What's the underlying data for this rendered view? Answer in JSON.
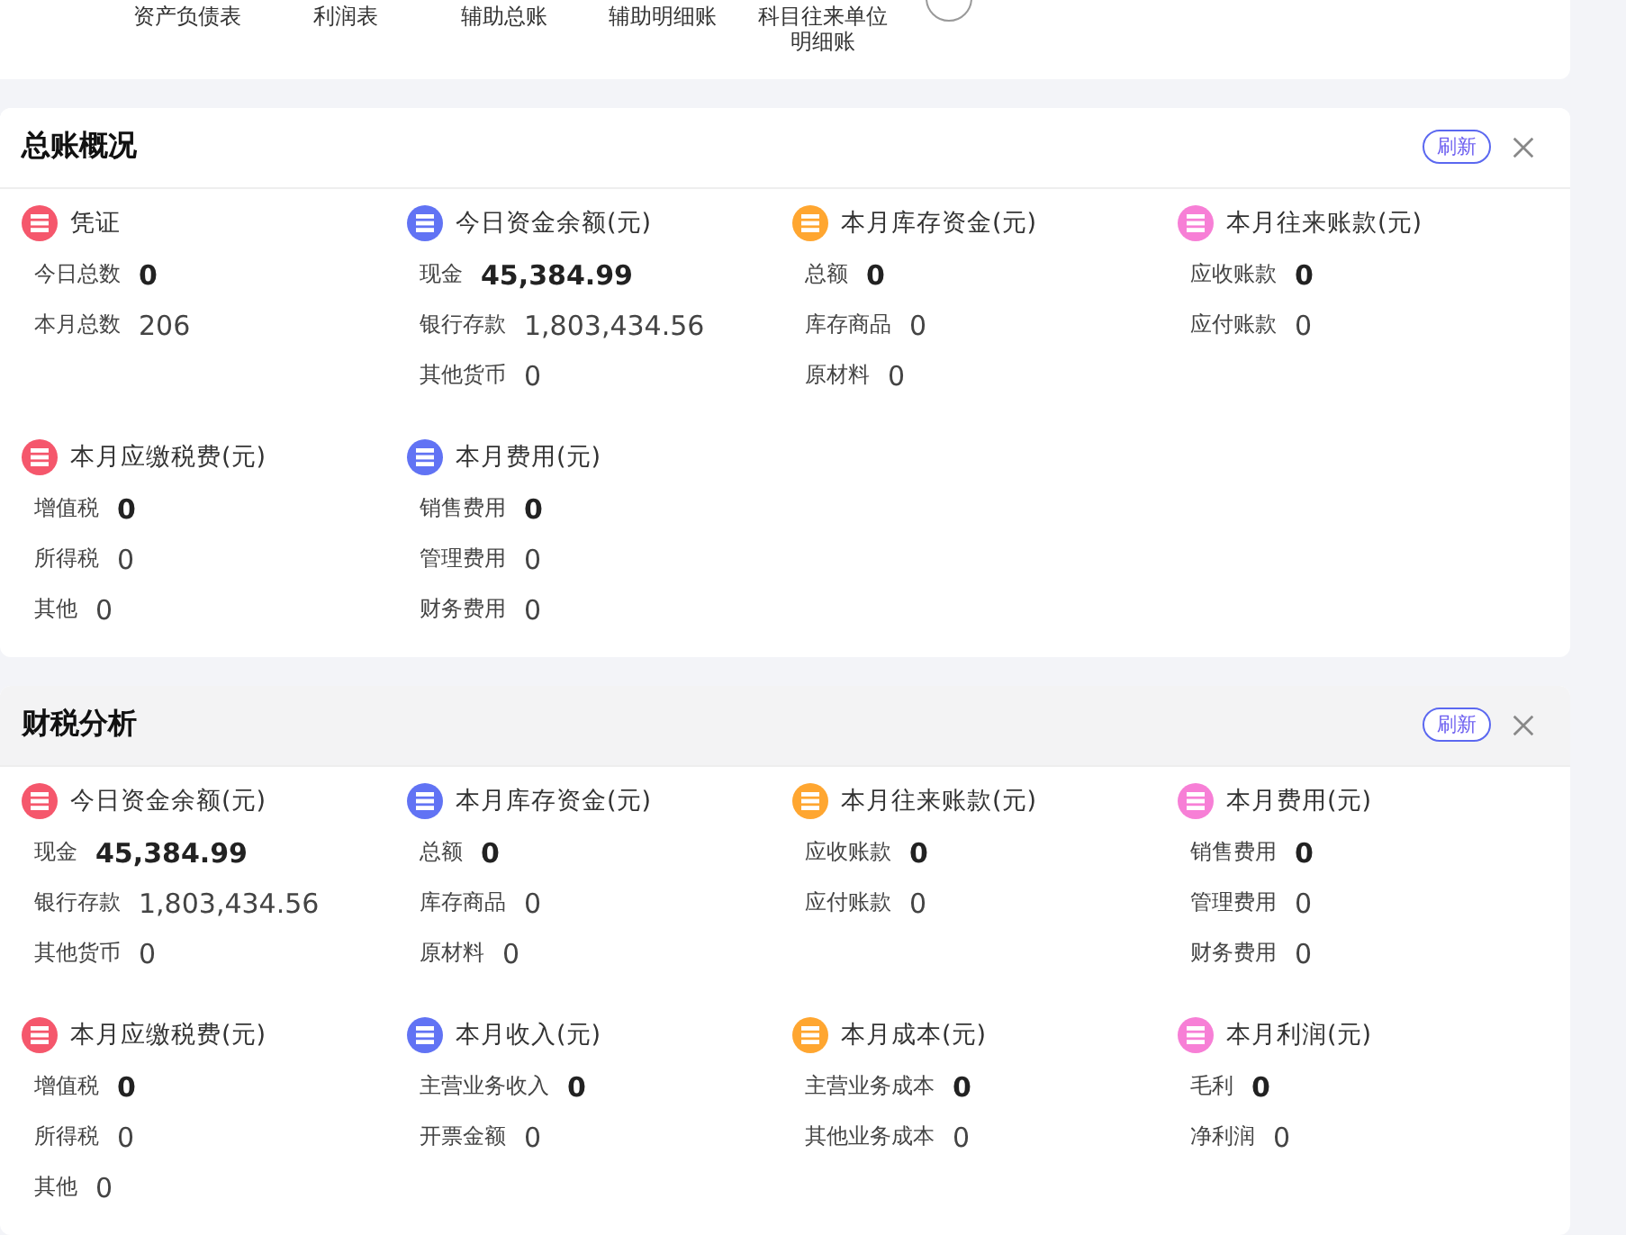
{
  "shortcuts": [
    {
      "label": "资产负债表"
    },
    {
      "label": "利润表"
    },
    {
      "label": "辅助总账"
    },
    {
      "label": "辅助明细账"
    },
    {
      "label": "科目往来单位明细账"
    }
  ],
  "panels": [
    {
      "title": "总账概况",
      "header_highlighted": false,
      "refresh_label": "刷新",
      "groups": [
        {
          "title": "凭证",
          "color": "#f5576c",
          "rows": [
            {
              "label": "今日总数",
              "value": "0",
              "bold": true
            },
            {
              "label": "本月总数",
              "value": "206",
              "bold": false
            }
          ]
        },
        {
          "title": "今日资金余额(元)",
          "color": "#6173f4",
          "rows": [
            {
              "label": "现金",
              "value": "45,384.99",
              "bold": true
            },
            {
              "label": "银行存款",
              "value": "1,803,434.56",
              "bold": false
            },
            {
              "label": "其他货币",
              "value": "0",
              "bold": false
            }
          ]
        },
        {
          "title": "本月库存资金(元)",
          "color": "#ffa630",
          "rows": [
            {
              "label": "总额",
              "value": "0",
              "bold": true
            },
            {
              "label": "库存商品",
              "value": "0",
              "bold": false
            },
            {
              "label": "原材料",
              "value": "0",
              "bold": false
            }
          ]
        },
        {
          "title": "本月往来账款(元)",
          "color": "#f77fd6",
          "rows": [
            {
              "label": "应收账款",
              "value": "0",
              "bold": true
            },
            {
              "label": "应付账款",
              "value": "0",
              "bold": false
            }
          ]
        },
        {
          "title": "本月应缴税费(元)",
          "color": "#f5576c",
          "rows": [
            {
              "label": "增值税",
              "value": "0",
              "bold": true
            },
            {
              "label": "所得税",
              "value": "0",
              "bold": false
            },
            {
              "label": "其他",
              "value": "0",
              "bold": false
            }
          ]
        },
        {
          "title": "本月费用(元)",
          "color": "#6173f4",
          "rows": [
            {
              "label": "销售费用",
              "value": "0",
              "bold": true
            },
            {
              "label": "管理费用",
              "value": "0",
              "bold": false
            },
            {
              "label": "财务费用",
              "value": "0",
              "bold": false
            }
          ]
        }
      ]
    },
    {
      "title": "财税分析",
      "header_highlighted": true,
      "refresh_label": "刷新",
      "groups": [
        {
          "title": "今日资金余额(元)",
          "color": "#f5576c",
          "rows": [
            {
              "label": "现金",
              "value": "45,384.99",
              "bold": true
            },
            {
              "label": "银行存款",
              "value": "1,803,434.56",
              "bold": false
            },
            {
              "label": "其他货币",
              "value": "0",
              "bold": false
            }
          ]
        },
        {
          "title": "本月库存资金(元)",
          "color": "#6173f4",
          "rows": [
            {
              "label": "总额",
              "value": "0",
              "bold": true
            },
            {
              "label": "库存商品",
              "value": "0",
              "bold": false
            },
            {
              "label": "原材料",
              "value": "0",
              "bold": false
            }
          ]
        },
        {
          "title": "本月往来账款(元)",
          "color": "#ffa630",
          "rows": [
            {
              "label": "应收账款",
              "value": "0",
              "bold": true
            },
            {
              "label": "应付账款",
              "value": "0",
              "bold": false
            }
          ]
        },
        {
          "title": "本月费用(元)",
          "color": "#f77fd6",
          "rows": [
            {
              "label": "销售费用",
              "value": "0",
              "bold": true
            },
            {
              "label": "管理费用",
              "value": "0",
              "bold": false
            },
            {
              "label": "财务费用",
              "value": "0",
              "bold": false
            }
          ]
        },
        {
          "title": "本月应缴税费(元)",
          "color": "#f5576c",
          "rows": [
            {
              "label": "增值税",
              "value": "0",
              "bold": true
            },
            {
              "label": "所得税",
              "value": "0",
              "bold": false
            },
            {
              "label": "其他",
              "value": "0",
              "bold": false
            }
          ]
        },
        {
          "title": "本月收入(元)",
          "color": "#6173f4",
          "rows": [
            {
              "label": "主营业务收入",
              "value": "0",
              "bold": true
            },
            {
              "label": "开票金额",
              "value": "0",
              "bold": false
            }
          ]
        },
        {
          "title": "本月成本(元)",
          "color": "#ffa630",
          "rows": [
            {
              "label": "主营业务成本",
              "value": "0",
              "bold": true
            },
            {
              "label": "其他业务成本",
              "value": "0",
              "bold": false
            }
          ]
        },
        {
          "title": "本月利润(元)",
          "color": "#f77fd6",
          "rows": [
            {
              "label": "毛利",
              "value": "0",
              "bold": true
            },
            {
              "label": "净利润",
              "value": "0",
              "bold": false
            }
          ]
        }
      ]
    }
  ]
}
